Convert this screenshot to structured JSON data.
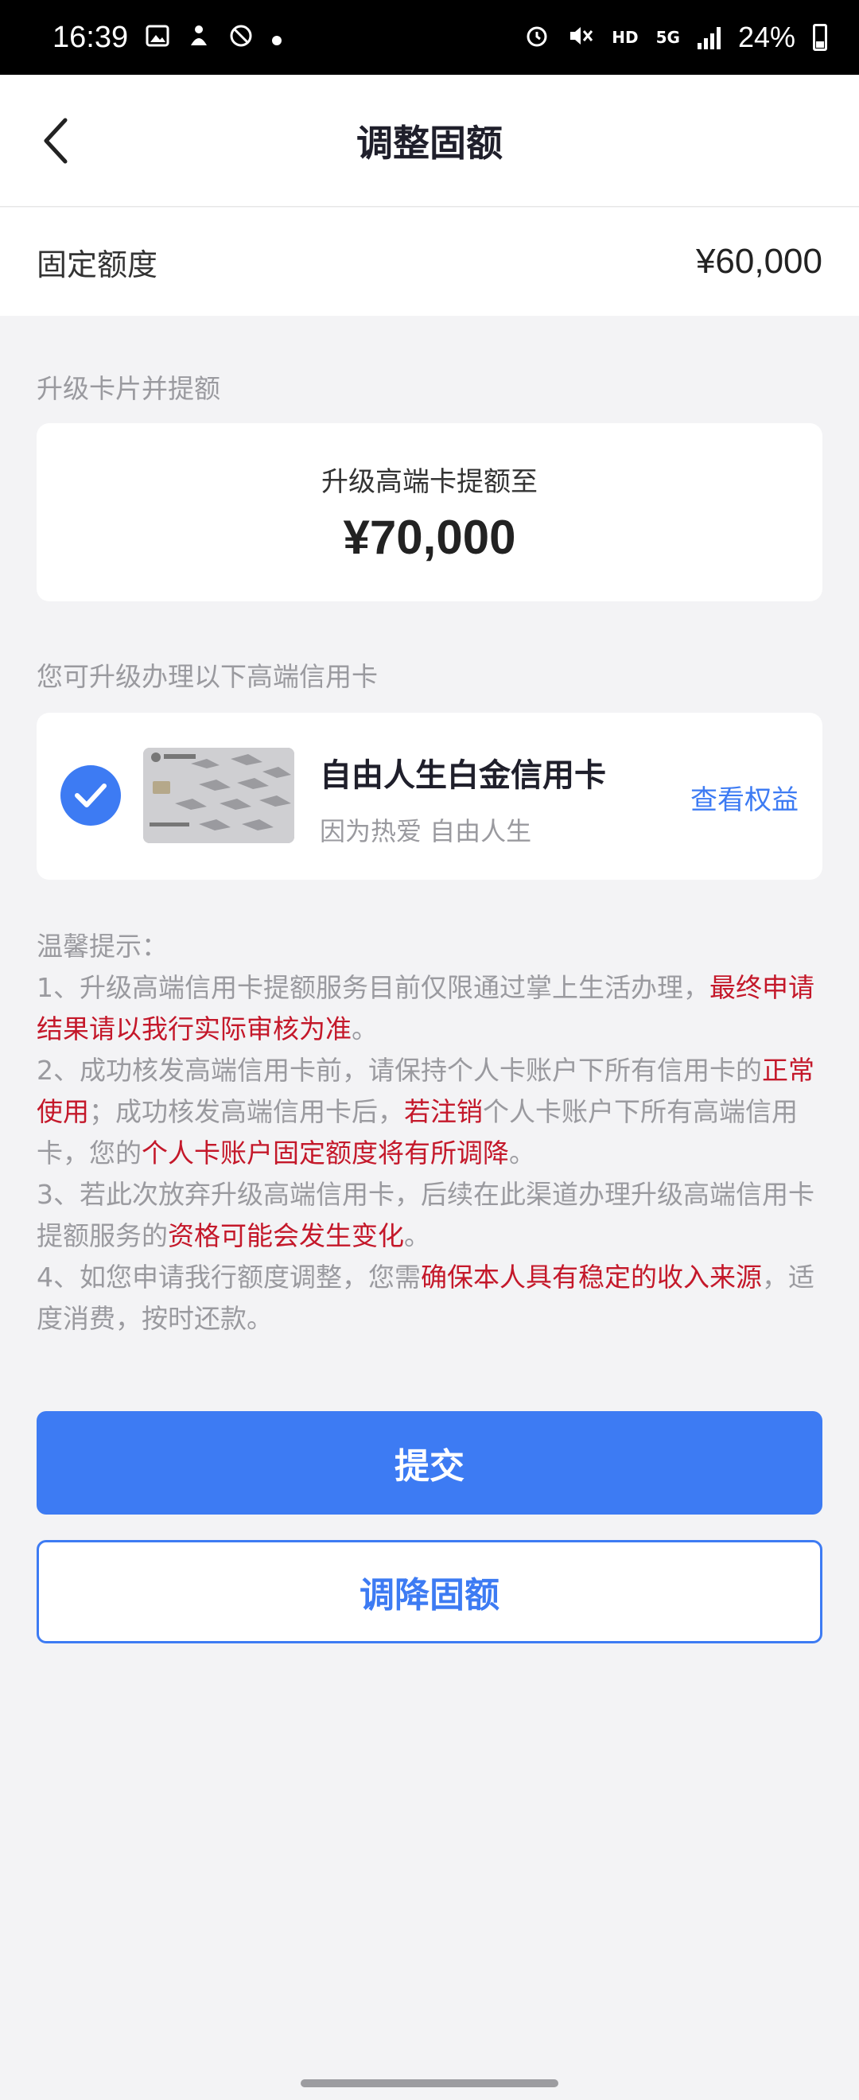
{
  "status_bar": {
    "time": "16:39",
    "network_label": "HD",
    "network_type": "5G",
    "battery": "24%",
    "icons": [
      "image-icon",
      "notification-icon",
      "blocked-icon",
      "dot-icon",
      "alarm-icon",
      "mute-icon",
      "signal-icon",
      "battery-icon"
    ]
  },
  "nav": {
    "title": "调整固额"
  },
  "fixed_limit": {
    "label": "固定额度",
    "value": "¥60,000"
  },
  "upgrade_section": {
    "label": "升级卡片并提额",
    "card_text": "升级高端卡提额至",
    "amount": "¥70,000"
  },
  "card_section": {
    "label": "您可升级办理以下高端信用卡",
    "card_name": "自由人生白金信用卡",
    "card_slogan": "因为热爱 自由人生",
    "link_label": "查看权益",
    "selected": true
  },
  "tips": {
    "title": "温馨提示：",
    "item1_a": "1、升级高端信用卡提额服务目前仅限通过掌上生活办理，",
    "item1_b": "最终申请结果请以我行实际审核为准",
    "item1_c": "。",
    "item2_a": "2、成功核发高端信用卡前，请保持个人卡账户下所有信用卡的",
    "item2_b": "正常使用",
    "item2_c": "；成功核发高端信用卡后，",
    "item2_d": "若注销",
    "item2_e": "个人卡账户下所有高端信用卡，您的",
    "item2_f": "个人卡账户固定额度将有所调降",
    "item2_g": "。",
    "item3_a": "3、若此次放弃升级高端信用卡，后续在此渠道办理升级高端信用卡提额服务的",
    "item3_b": "资格可能会发生变化",
    "item3_c": "。",
    "item4_a": "4、如您申请我行额度调整，您需",
    "item4_b": "确保本人具有稳定的收入来源",
    "item4_c": "，适度消费，按时还款。"
  },
  "buttons": {
    "submit": "提交",
    "decrease": "调降固额"
  },
  "colors": {
    "accent": "#3d7bf3",
    "warning_red": "#c4182a",
    "muted_text": "#9a9a9f"
  }
}
